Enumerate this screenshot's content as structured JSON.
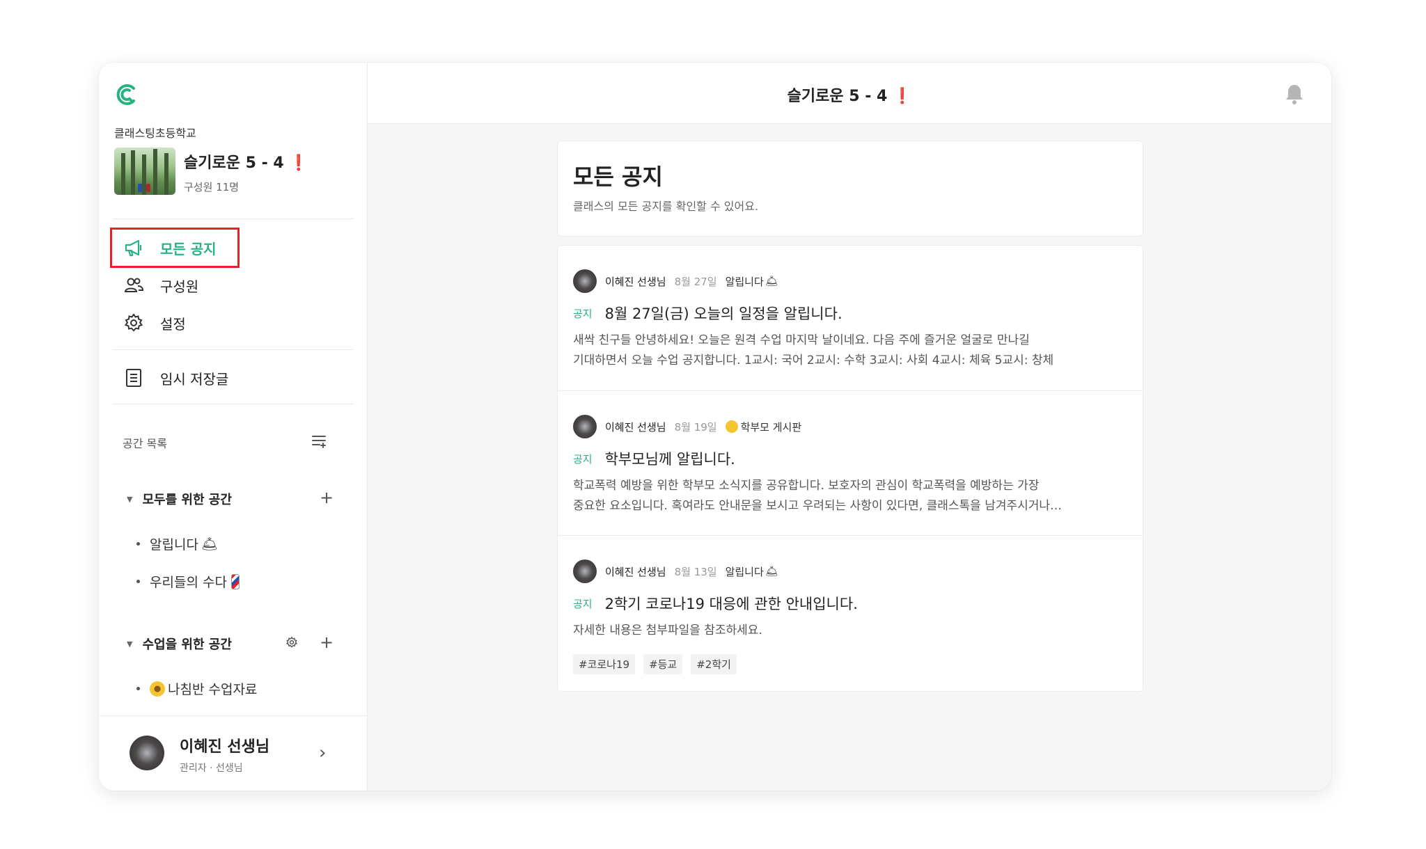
{
  "sidebar": {
    "school_name": "클래스팅초등학교",
    "class_title": "슬기로운 5 - 4",
    "member_count": "구성원 11명",
    "nav": {
      "notices": "모든 공지",
      "members": "구성원",
      "settings": "설정",
      "drafts": "임시 저장글"
    },
    "spaces_header": "공간 목록",
    "groups": [
      {
        "title": "모두를 위한 공간",
        "items": [
          "알립니다",
          "우리들의 수다"
        ]
      },
      {
        "title": "수업을 위한 공간",
        "items": [
          "나침반 수업자료"
        ]
      }
    ],
    "profile": {
      "name": "이혜진 선생님",
      "role": "관리자 · 선생님"
    }
  },
  "topbar": {
    "title": "슬기로운 5 - 4"
  },
  "hero": {
    "title": "모든 공지",
    "subtitle": "클래스의 모든 공지를 확인할 수 있어요."
  },
  "posts": [
    {
      "author": "이혜진 선생님",
      "date": "8월 27일",
      "space": "알립니다",
      "tag": "공지",
      "title": "8월 27일(금) 오늘의 일정을 알립니다.",
      "body_line1": "새싹 친구들 안녕하세요! 오늘은 원격 수업 마지막 날이네요. 다음 주에 즐거운 얼굴로 만나길",
      "body_line2": "기대하면서 오늘 수업 공지합니다. 1교시: 국어 2교시: 수학 3교시: 사회 4교시: 체육 5교시: 창체"
    },
    {
      "author": "이혜진 선생님",
      "date": "8월 19일",
      "space": "학부모 게시판",
      "tag": "공지",
      "title": "학부모님께 알립니다.",
      "body_line1": "학교폭력 예방을 위한 학부모 소식지를 공유합니다. 보호자의 관심이 학교폭력을 예방하는 가장",
      "body_line2": "중요한 요소입니다. 혹여라도 안내문을 보시고 우려되는 사항이 있다면, 클래스톡을 남겨주시거나…"
    },
    {
      "author": "이혜진 선생님",
      "date": "8월 13일",
      "space": "알립니다",
      "tag": "공지",
      "title": "2학기 코로나19 대응에 관한 안내입니다.",
      "body_line1": "자세한 내용은 첨부파일을 참조하세요.",
      "hashtags": [
        "#코로나19",
        "#등교",
        "#2학기"
      ]
    }
  ],
  "colors": {
    "accent": "#27b37f",
    "highlight_box": "#e8202a"
  },
  "icons": {
    "logo": "classting-logo-icon",
    "notices": "megaphone-icon",
    "members": "people-icon",
    "settings": "gear-icon",
    "drafts": "document-icon",
    "bell": "bell-icon"
  }
}
